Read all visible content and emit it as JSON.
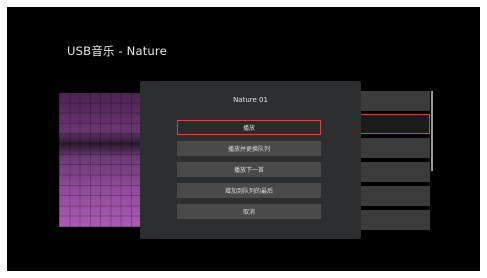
{
  "page": {
    "title": "USB音乐 - Nature"
  },
  "dialog": {
    "title": "Nature 01",
    "options": [
      {
        "label": "播放",
        "selected": true
      },
      {
        "label": "播放并更换队列",
        "selected": false
      },
      {
        "label": "播放下一首",
        "selected": false
      },
      {
        "label": "增加到队列的最后",
        "selected": false
      },
      {
        "label": "取消",
        "selected": false
      }
    ]
  },
  "colors": {
    "background": "#000000",
    "dialog": "#2d2e2f",
    "menu_item": "#4a4a4a",
    "focus_border": "#d44a3c",
    "track_row": "#3b3b3b"
  }
}
